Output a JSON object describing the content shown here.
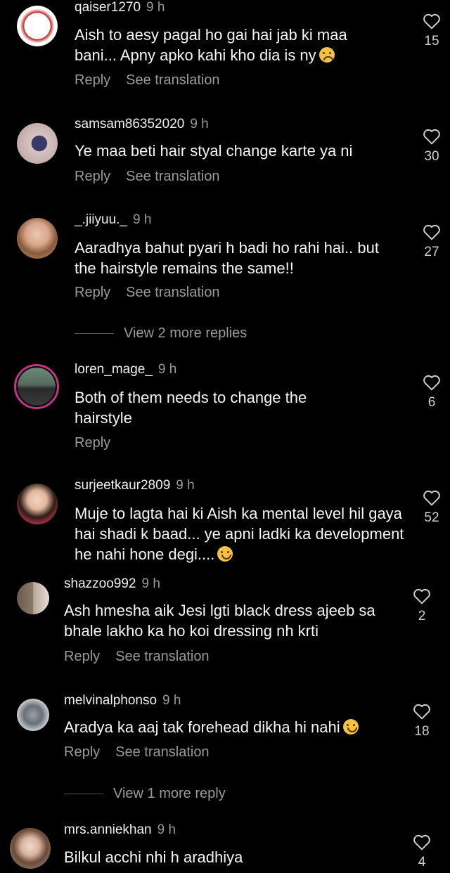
{
  "actions": {
    "reply": "Reply",
    "see_translation": "See translation"
  },
  "comments": [
    {
      "username": "qaiser1270",
      "time": "9 h",
      "text": "Aish to aesy pagal ho gai hai jab ki maa bani... Apny apko kahi kho dia is ny",
      "emoji": "sad-face",
      "likes": "15",
      "translation": true
    },
    {
      "username": "samsam86352020",
      "time": "9 h",
      "text": "Ye maa beti hair styal change karte ya ni",
      "likes": "30",
      "translation": true
    },
    {
      "username": "_.jiiyuu._",
      "time": "9 h",
      "text": "Aaradhya bahut pyari h badi ho rahi hai.. but the hairstyle remains the same!!",
      "likes": "27",
      "translation": true
    },
    {
      "username": "loren_mage_",
      "time": "9 h",
      "text": "Both of them  needs to change the hairstyle",
      "likes": "6",
      "translation": false
    },
    {
      "username": "surjeetkaur2809",
      "time": "9 h",
      "text": "Muje to lagta hai ki Aish ka mental level hil gaya hai shadi k baad... ye apni ladki ka development he nahi hone degi....",
      "emoji": "grinning-sweat-face",
      "likes": "52",
      "translation": false
    },
    {
      "username": "shazzoo992",
      "time": "9 h",
      "text": "Ash hmesha aik Jesi lgti black dress ajeeb sa bhale lakho ka ho koi dressing nh krti",
      "likes": "2",
      "translation": true
    },
    {
      "username": "melvinalphonso",
      "time": "9 h",
      "text": "Aradya ka aaj tak forehead dikha hi nahi",
      "emoji": "grinning-sweat-face",
      "likes": "18",
      "translation": true
    },
    {
      "username": "mrs.anniekhan",
      "time": "9 h",
      "text": "Bilkul acchi nhi h aradhiya",
      "likes": "4",
      "translation": false
    }
  ],
  "view_more": [
    {
      "label": "View 2 more replies"
    },
    {
      "label": "View 1 more reply"
    }
  ],
  "colors": {
    "background": "#000000",
    "secondary_text": "#9a9a9a",
    "story_ring": "#c13584"
  },
  "icons": {
    "like": "heart-outline-icon"
  }
}
